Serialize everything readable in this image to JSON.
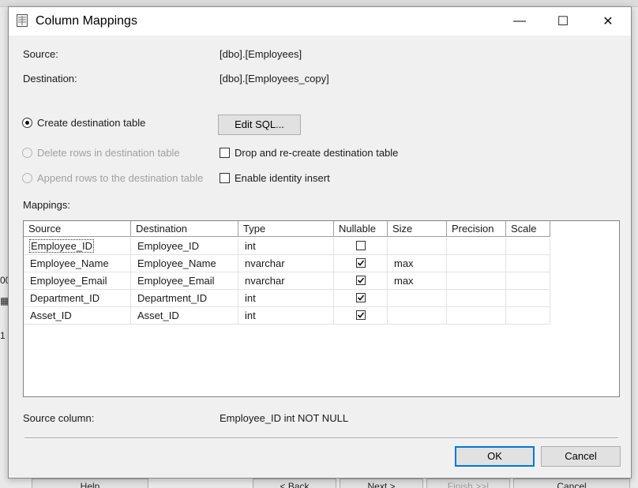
{
  "background": {
    "left_fragments": [
      "00",
      "▦",
      "1"
    ],
    "buttons": [
      {
        "label": "Help",
        "disabled": false
      },
      {
        "label": "< Back",
        "disabled": false
      },
      {
        "label": "Next >",
        "disabled": false
      },
      {
        "label": "Finish >>|",
        "disabled": true
      },
      {
        "label": "Cancel",
        "disabled": false
      }
    ]
  },
  "dialog": {
    "title": "Column Mappings",
    "window_controls": {
      "minimize": "—",
      "maximize": "☐",
      "close": "✕"
    },
    "source_label": "Source:",
    "source_value": "[dbo].[Employees]",
    "destination_label": "Destination:",
    "destination_value": "[dbo].[Employees_copy]",
    "options": {
      "create_table": {
        "label": "Create destination table",
        "selected": true,
        "enabled": true
      },
      "delete_rows": {
        "label": "Delete rows in destination table",
        "selected": false,
        "enabled": false
      },
      "append_rows": {
        "label": "Append rows to the destination table",
        "selected": false,
        "enabled": false
      }
    },
    "edit_sql_label": "Edit SQL...",
    "drop_recreate": {
      "label": "Drop and re-create destination table",
      "checked": false
    },
    "identity_insert": {
      "label": "Enable identity insert",
      "checked": false
    },
    "mappings_label": "Mappings:",
    "grid": {
      "columns": [
        "Source",
        "Destination",
        "Type",
        "Nullable",
        "Size",
        "Precision",
        "Scale"
      ],
      "rows": [
        {
          "source": "Employee_ID",
          "destination": "Employee_ID",
          "type": "int",
          "nullable": false,
          "size": "",
          "precision": "",
          "scale": ""
        },
        {
          "source": "Employee_Name",
          "destination": "Employee_Name",
          "type": "nvarchar",
          "nullable": true,
          "size": "max",
          "precision": "",
          "scale": ""
        },
        {
          "source": "Employee_Email",
          "destination": "Employee_Email",
          "type": "nvarchar",
          "nullable": true,
          "size": "max",
          "precision": "",
          "scale": ""
        },
        {
          "source": "Department_ID",
          "destination": "Department_ID",
          "type": "int",
          "nullable": true,
          "size": "",
          "precision": "",
          "scale": ""
        },
        {
          "source": "Asset_ID",
          "destination": "Asset_ID",
          "type": "int",
          "nullable": true,
          "size": "",
          "precision": "",
          "scale": ""
        }
      ]
    },
    "source_column_label": "Source column:",
    "source_column_value": "Employee_ID int NOT NULL",
    "ok_label": "OK",
    "cancel_label": "Cancel"
  }
}
